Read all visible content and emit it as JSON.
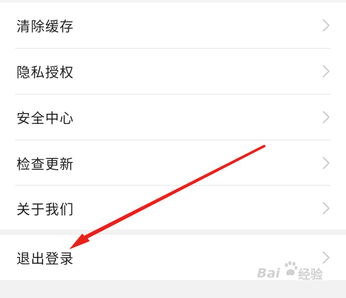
{
  "settings": {
    "items": [
      {
        "label": "清除缓存",
        "icon": "chevron-right-icon"
      },
      {
        "label": "隐私授权",
        "icon": "chevron-right-icon"
      },
      {
        "label": "安全中心",
        "icon": "chevron-right-icon"
      },
      {
        "label": "检查更新",
        "icon": "chevron-right-icon"
      },
      {
        "label": "关于我们",
        "icon": "chevron-right-icon"
      }
    ],
    "logout": {
      "label": "退出登录",
      "icon": "chevron-right-icon"
    }
  },
  "annotation": {
    "type": "red-arrow",
    "color": "#e8211b",
    "points_to": "退出登录"
  },
  "watermark": {
    "brand": "Bai",
    "text": "经验"
  },
  "colors": {
    "background": "#f2f2f2",
    "row_background": "#ffffff",
    "text": "#1f1f1f",
    "chevron": "#c8c8c8",
    "divider": "#e4e4e4",
    "arrow": "#e8211b"
  }
}
